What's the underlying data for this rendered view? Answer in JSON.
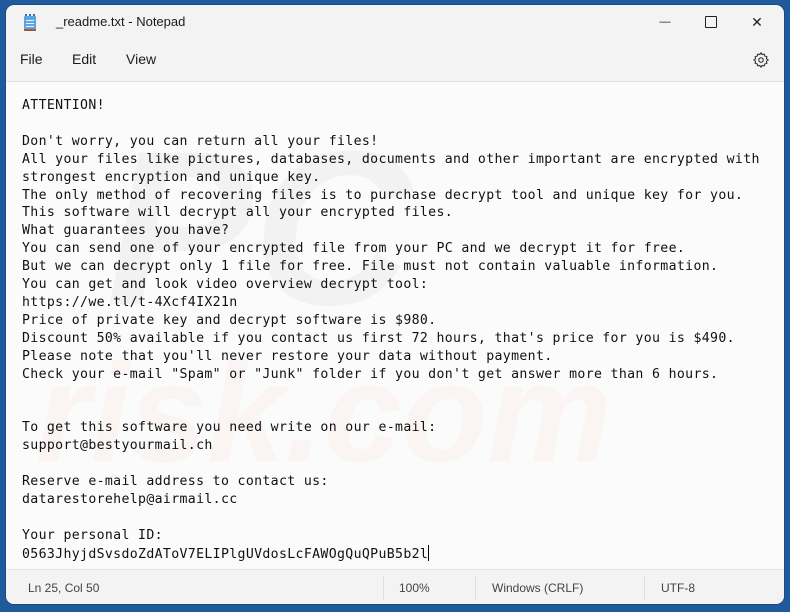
{
  "window": {
    "title": "_readme.txt - Notepad",
    "app_icon": "notepad-icon",
    "controls": {
      "minimize": "—",
      "maximize": "☐",
      "close": "✕"
    }
  },
  "menu": {
    "items": [
      "File",
      "Edit",
      "View"
    ],
    "settings_icon": "gear-icon"
  },
  "editor": {
    "lines": [
      "ATTENTION!",
      "",
      "Don't worry, you can return all your files!",
      "All your files like pictures, databases, documents and other important are encrypted with",
      "strongest encryption and unique key.",
      "The only method of recovering files is to purchase decrypt tool and unique key for you.",
      "This software will decrypt all your encrypted files.",
      "What guarantees you have?",
      "You can send one of your encrypted file from your PC and we decrypt it for free.",
      "But we can decrypt only 1 file for free. File must not contain valuable information.",
      "You can get and look video overview decrypt tool:",
      "https://we.tl/t-4Xcf4IX21n",
      "Price of private key and decrypt software is $980.",
      "Discount 50% available if you contact us first 72 hours, that's price for you is $490.",
      "Please note that you'll never restore your data without payment.",
      "Check your e-mail \"Spam\" or \"Junk\" folder if you don't get answer more than 6 hours.",
      "",
      "",
      "To get this software you need write on our e-mail:",
      "support@bestyourmail.ch",
      "",
      "Reserve e-mail address to contact us:",
      "datarestorehelp@airmail.cc",
      "",
      "Your personal ID:",
      "0563JhyjdSvsdoZdAToV7ELIPlgUVdosLcFAWOgQuQPuB5b2l"
    ]
  },
  "statusbar": {
    "position": "Ln 25, Col 50",
    "zoom": "100%",
    "line_ending": "Windows (CRLF)",
    "encoding": "UTF-8"
  },
  "watermark": {
    "line1": "PC",
    "line2": "risk.com"
  }
}
